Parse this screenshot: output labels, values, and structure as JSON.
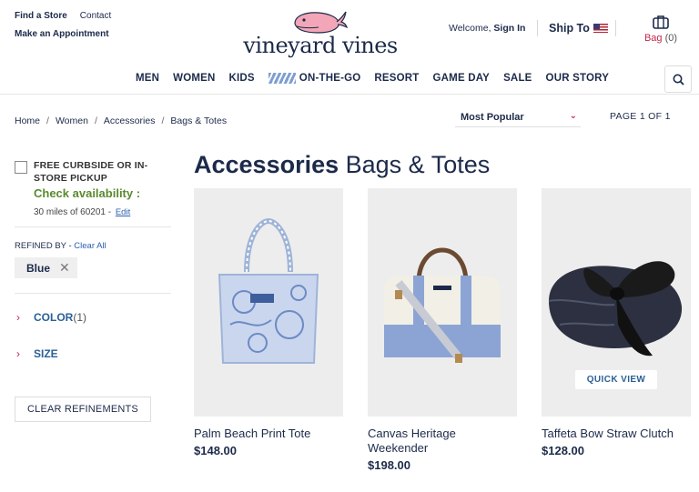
{
  "header": {
    "links": {
      "find_store": "Find a Store",
      "contact": "Contact",
      "appointment": "Make an Appointment"
    },
    "logo_text": "vineyard vines",
    "welcome_prefix": "Welcome,",
    "sign_in": "Sign In",
    "ship_to": "Ship To",
    "bag_label": "Bag",
    "bag_count": "(0)",
    "nav": [
      "MEN",
      "WOMEN",
      "KIDS",
      "ON-THE-GO",
      "RESORT",
      "GAME DAY",
      "SALE",
      "OUR STORY"
    ]
  },
  "breadcrumb": [
    "Home",
    "Women",
    "Accessories",
    "Bags & Totes"
  ],
  "sort": {
    "selected": "Most Popular"
  },
  "pagination": {
    "text": "PAGE 1 OF 1"
  },
  "sidebar": {
    "pickup_label": "FREE CURBSIDE OR IN-STORE PICKUP",
    "check_availability": "Check availability :",
    "miles_text": "30 miles of 60201 -",
    "edit": "Edit",
    "refined_by": "REFINED BY -",
    "clear_all": "Clear All",
    "chip": "Blue",
    "facets": [
      {
        "label": "COLOR",
        "count": "(1)"
      },
      {
        "label": "SIZE",
        "count": ""
      }
    ],
    "clear_refinements": "CLEAR REFINEMENTS"
  },
  "heading": {
    "bold": "Accessories",
    "rest": "Bags & Totes"
  },
  "products": [
    {
      "name": "Palm Beach Print Tote",
      "price": "$148.00"
    },
    {
      "name": "Canvas Heritage Weekender",
      "price": "$198.00"
    },
    {
      "name": "Taffeta Bow Straw Clutch",
      "price": "$128.00",
      "quick_view": "QUICK VIEW"
    }
  ],
  "colors": {
    "navy": "#1c2a4a",
    "red": "#c2274c",
    "green": "#5a8a2e",
    "link": "#2a5fb0"
  }
}
